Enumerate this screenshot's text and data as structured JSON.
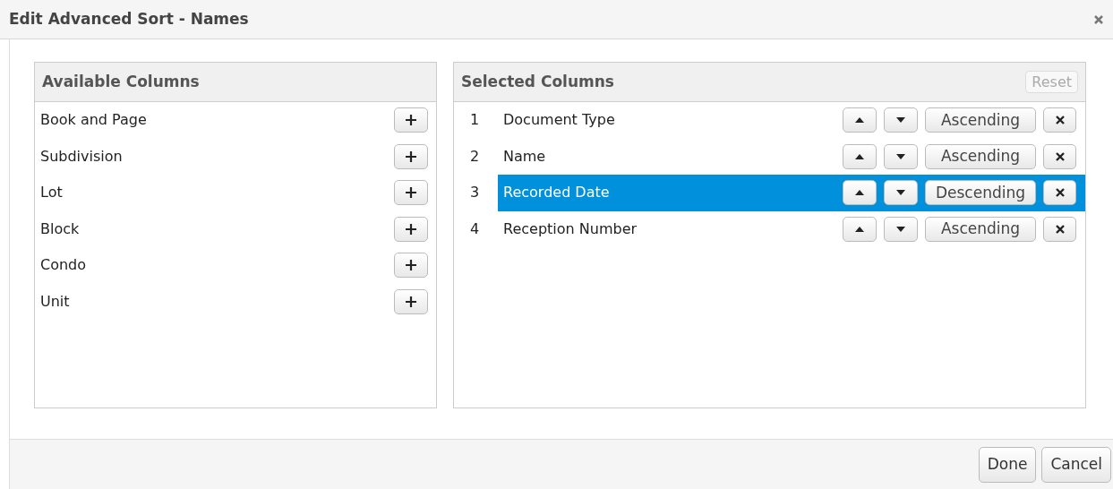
{
  "window": {
    "title": "Edit Advanced Sort - Names"
  },
  "available": {
    "title": "Available Columns",
    "items": [
      {
        "label": "Book and Page"
      },
      {
        "label": "Subdivision"
      },
      {
        "label": "Lot"
      },
      {
        "label": "Block"
      },
      {
        "label": "Condo"
      },
      {
        "label": "Unit"
      }
    ]
  },
  "selected_columns": {
    "title": "Selected Columns",
    "reset": {
      "label": "Reset",
      "disabled": true
    },
    "rows": [
      {
        "number": "1",
        "label": "Document Type",
        "order": "Ascending",
        "selected": false
      },
      {
        "number": "2",
        "label": "Name",
        "order": "Ascending",
        "selected": false
      },
      {
        "number": "3",
        "label": "Recorded Date",
        "order": "Descending",
        "selected": true
      },
      {
        "number": "4",
        "label": "Reception Number",
        "order": "Ascending",
        "selected": false
      }
    ]
  },
  "buttons": [
    {
      "label": "Done"
    },
    {
      "label": "Cancel"
    }
  ]
}
